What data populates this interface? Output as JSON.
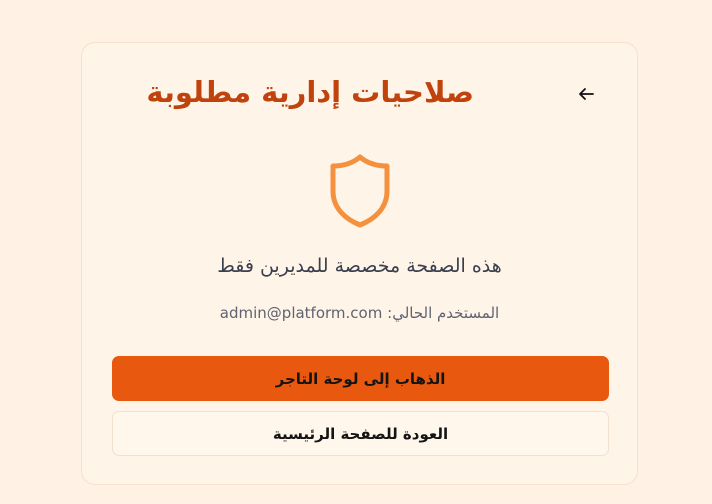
{
  "page": {
    "title": "صلاحيات إدارية مطلوبة",
    "back_icon": "arrow-left-icon",
    "shield_icon": "shield-icon",
    "message": "هذه الصفحة مخصصة للمديرين فقط",
    "current_user_label": ":المستخدم الحالي",
    "current_user_email": "admin@platform.com"
  },
  "buttons": {
    "merchant_dashboard": "الذهاب إلى لوحة التاجر",
    "home": "العودة للصفحة الرئيسية"
  },
  "colors": {
    "background": "#fff1e3",
    "title": "#c0420d",
    "shield": "#f4913f",
    "primary_button": "#e8580e"
  }
}
